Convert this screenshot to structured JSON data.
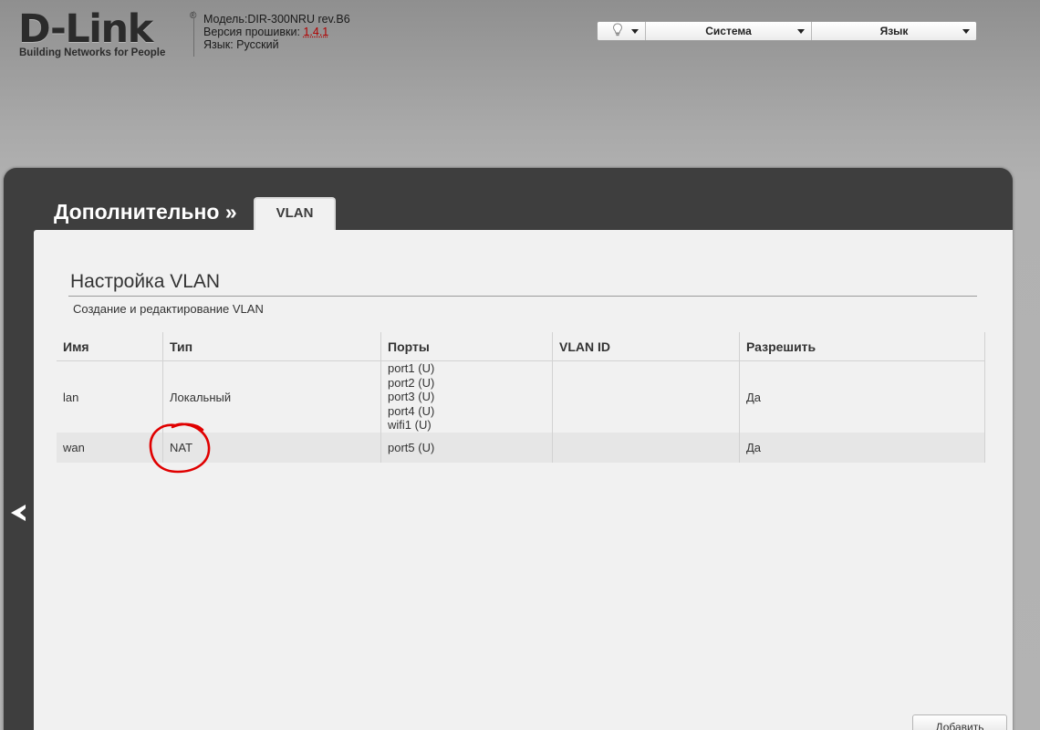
{
  "header": {
    "logo": {
      "brand": "D-Link",
      "registered": "®",
      "tagline": "Building Networks for People"
    },
    "device": {
      "model_label": "Модель:",
      "model_value": "DIR-300NRU rev.B6",
      "firmware_label": "Версия прошивки:",
      "firmware_value": "1.4.1",
      "language_label": "Язык:",
      "language_value": "Русский"
    },
    "topmenu": {
      "bulb_icon": "lightbulb-icon",
      "system_label": "Система",
      "language_label": "Язык"
    }
  },
  "panel": {
    "title": "Дополнительно »",
    "tab_label": "VLAN",
    "back_icon": "chevron-left-icon"
  },
  "section": {
    "title": "Настройка VLAN",
    "description": "Создание и редактирование VLAN"
  },
  "table": {
    "columns": [
      "Имя",
      "Тип",
      "Порты",
      "VLAN ID",
      "Разрешить"
    ],
    "rows": [
      {
        "name": "lan",
        "type": "Локальный",
        "ports": [
          "port1 (U)",
          "port2 (U)",
          "port3 (U)",
          "port4 (U)",
          "wifi1 (U)"
        ],
        "vlan_id": "",
        "enabled": "Да"
      },
      {
        "name": "wan",
        "type": "NAT",
        "ports": [
          "port5 (U)"
        ],
        "vlan_id": "",
        "enabled": "Да"
      }
    ]
  },
  "buttons": {
    "add_label": "Добавить"
  },
  "colors": {
    "panel_bg": "#3e3e3e",
    "content_bg": "#f1f1f1",
    "firmware_link": "#b00000",
    "annotation_circle": "#e00000"
  }
}
